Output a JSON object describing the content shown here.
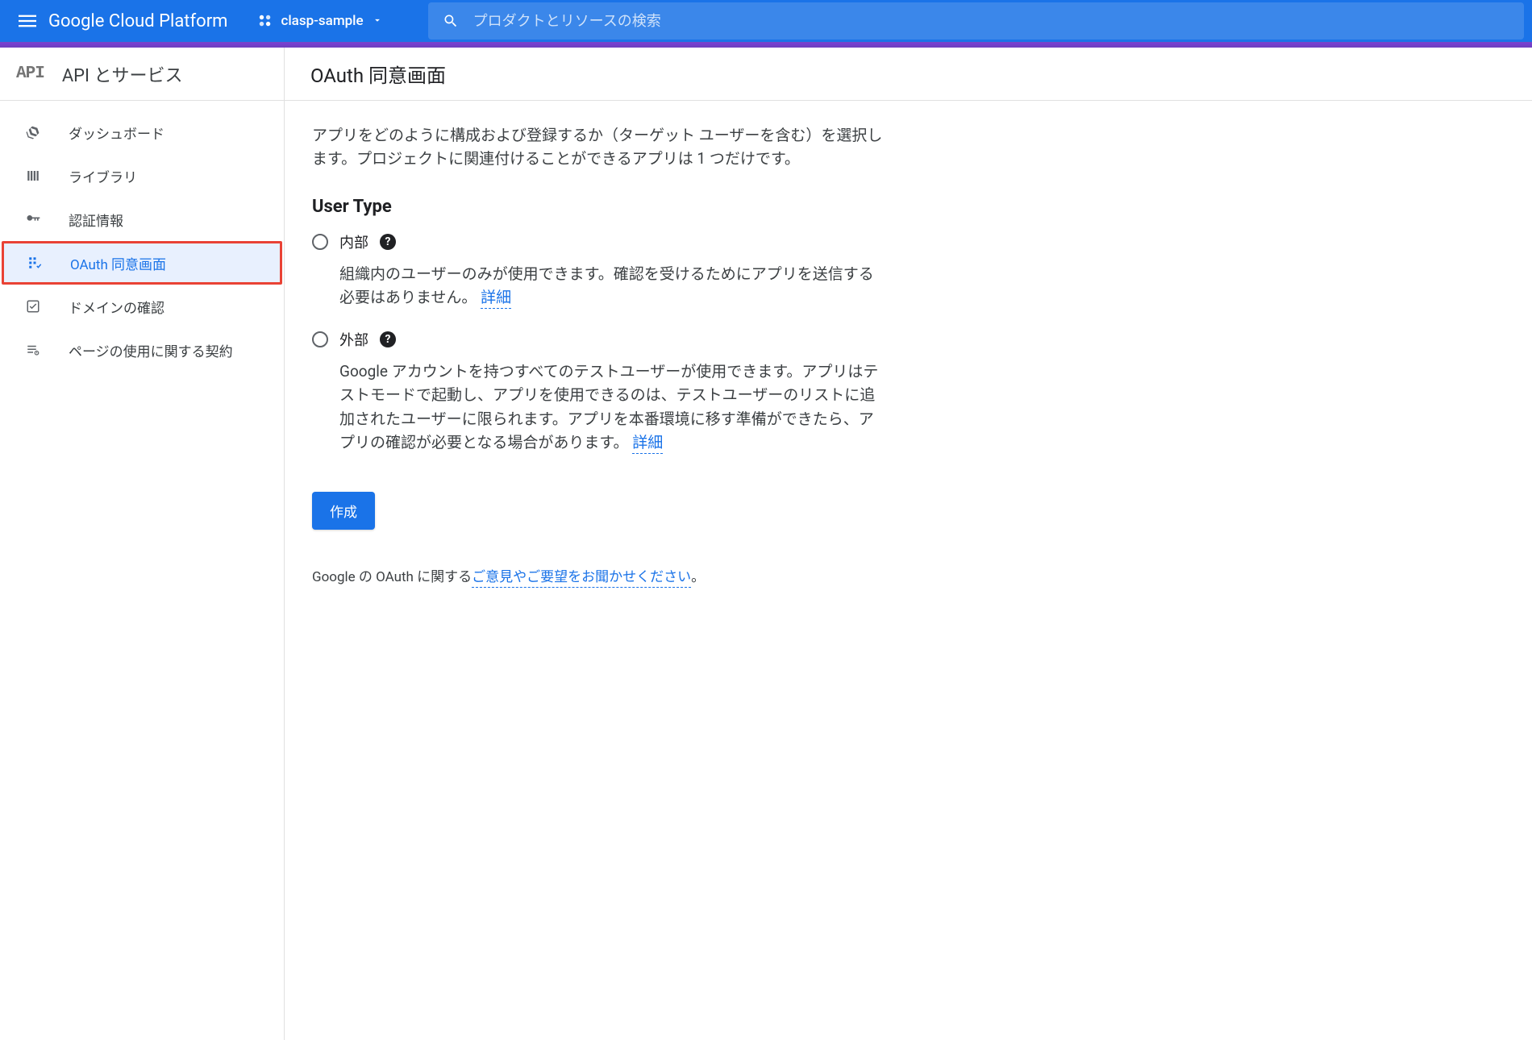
{
  "header": {
    "platform_name": "Google Cloud Platform",
    "project_name": "clasp-sample",
    "search_placeholder": "プロダクトとリソースの検索"
  },
  "sidebar": {
    "api_logo": "API",
    "title": "API とサービス",
    "items": [
      {
        "label": "ダッシュボード"
      },
      {
        "label": "ライブラリ"
      },
      {
        "label": "認証情報"
      },
      {
        "label": "OAuth 同意画面"
      },
      {
        "label": "ドメインの確認"
      },
      {
        "label": "ページの使用に関する契約"
      }
    ]
  },
  "main": {
    "title": "OAuth 同意画面",
    "intro": "アプリをどのように構成および登録するか（ターゲット ユーザーを含む）を選択します。プロジェクトに関連付けることができるアプリは 1 つだけです。",
    "section_title": "User Type",
    "options": {
      "internal": {
        "label": "内部",
        "desc": "組織内のユーザーのみが使用できます。確認を受けるためにアプリを送信する必要はありません。",
        "details": "詳細"
      },
      "external": {
        "label": "外部",
        "desc": "Google アカウントを持つすべてのテストユーザーが使用できます。アプリはテストモードで起動し、アプリを使用できるのは、テストユーザーのリストに追加されたユーザーに限られます。アプリを本番環境に移す準備ができたら、アプリの確認が必要となる場合があります。",
        "details": "詳細"
      }
    },
    "create_button": "作成",
    "feedback_prefix": "Google の OAuth に関する",
    "feedback_link": "ご意見やご要望をお聞かせください",
    "feedback_suffix": "。"
  }
}
